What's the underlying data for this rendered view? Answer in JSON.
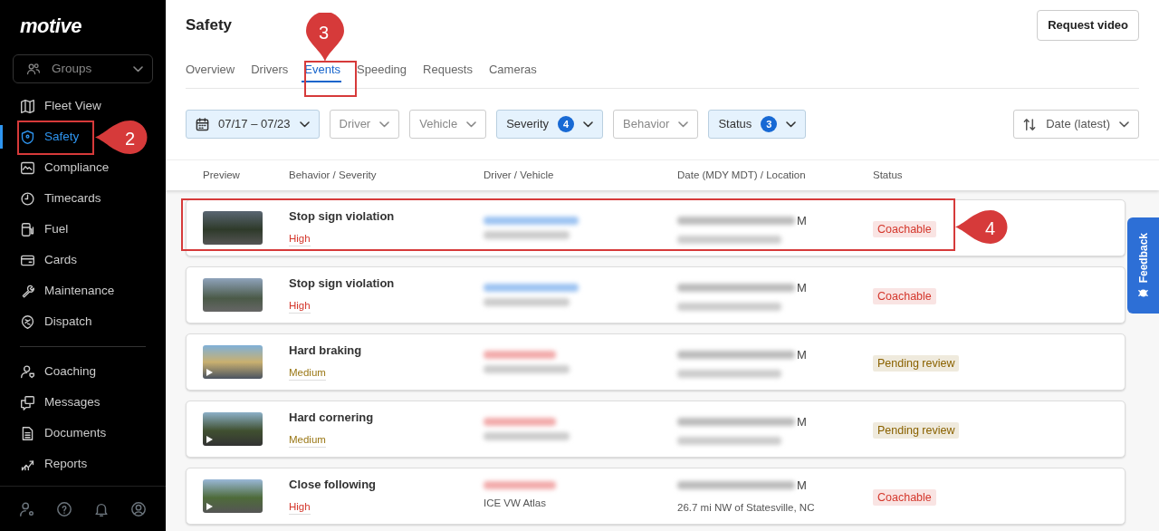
{
  "sidebar": {
    "logo": "motive",
    "groups": {
      "label": "Groups"
    },
    "nav_items": [
      {
        "label": "Fleet View",
        "selected": false
      },
      {
        "label": "Safety",
        "selected": true
      },
      {
        "label": "Compliance",
        "selected": false
      },
      {
        "label": "Timecards",
        "selected": false
      },
      {
        "label": "Fuel",
        "selected": false
      },
      {
        "label": "Cards",
        "selected": false
      },
      {
        "label": "Maintenance",
        "selected": false
      },
      {
        "label": "Dispatch",
        "selected": false
      }
    ],
    "secondary_items": [
      {
        "label": "Coaching",
        "selected": false
      },
      {
        "label": "Messages",
        "selected": false
      },
      {
        "label": "Documents",
        "selected": false
      },
      {
        "label": "Reports",
        "selected": false
      }
    ]
  },
  "header": {
    "title": "Safety",
    "button": "Request video"
  },
  "tabs": [
    {
      "label": "Overview",
      "selected": false
    },
    {
      "label": "Drivers",
      "selected": false
    },
    {
      "label": "Events",
      "selected": true
    },
    {
      "label": "Speeding",
      "selected": false
    },
    {
      "label": "Requests",
      "selected": false
    },
    {
      "label": "Cameras",
      "selected": false
    }
  ],
  "filters": [
    {
      "label": "07/17 – 07/23",
      "kind": "date",
      "active": true
    },
    {
      "label": "Driver",
      "kind": "select",
      "active": false
    },
    {
      "label": "Vehicle",
      "kind": "select",
      "active": false
    },
    {
      "label": "Severity",
      "kind": "select",
      "active": true,
      "count": "4"
    },
    {
      "label": "Behavior",
      "kind": "select",
      "active": false
    },
    {
      "label": "Status",
      "kind": "select",
      "active": true,
      "count": "3"
    }
  ],
  "sort": {
    "label": "Date (latest)"
  },
  "table": {
    "columns": [
      "Preview",
      "Behavior / Severity",
      "Driver / Vehicle",
      "Date (MDY MDT) / Location",
      "Status"
    ],
    "rows": [
      {
        "behavior": "Stop sign violation",
        "severity": {
          "label": "High",
          "color": "#d4372c"
        },
        "driver": {
          "color": "#9cc3f2"
        },
        "date_tail": "M",
        "status": {
          "label": "Coachable",
          "color": "#d4372c"
        },
        "video": false
      },
      {
        "behavior": "Stop sign violation",
        "severity": {
          "label": "High",
          "color": "#d4372c"
        },
        "driver": {
          "color": "#9cc3f2"
        },
        "date_tail": "M",
        "status": {
          "label": "Coachable",
          "color": "#d4372c"
        },
        "video": false
      },
      {
        "behavior": "Hard braking",
        "severity": {
          "label": "Medium",
          "color": "#9a7715"
        },
        "driver": {
          "color": "#f2aaaa"
        },
        "date_tail": "M",
        "status": {
          "label": "Pending review",
          "color": "#8a6200"
        },
        "video": true
      },
      {
        "behavior": "Hard cornering",
        "severity": {
          "label": "Medium",
          "color": "#9a7715"
        },
        "driver": {
          "color": "#f2aaaa"
        },
        "date_tail": "M",
        "status": {
          "label": "Pending review",
          "color": "#8a6200"
        },
        "video": true
      },
      {
        "behavior": "Close following",
        "severity": {
          "label": "High",
          "color": "#d4372c"
        },
        "driver": {
          "color": "#f2aaaa"
        },
        "vehicle": "ICE VW Atlas",
        "date_tail": "M",
        "location": "26.7 mi NW of Statesville, NC",
        "status": {
          "label": "Coachable",
          "color": "#d4372c"
        },
        "video": true
      }
    ]
  },
  "feedback_tab": {
    "label": "Feedback"
  },
  "annotations": [
    {
      "label": "2"
    },
    {
      "label": "3"
    },
    {
      "label": "4"
    }
  ]
}
